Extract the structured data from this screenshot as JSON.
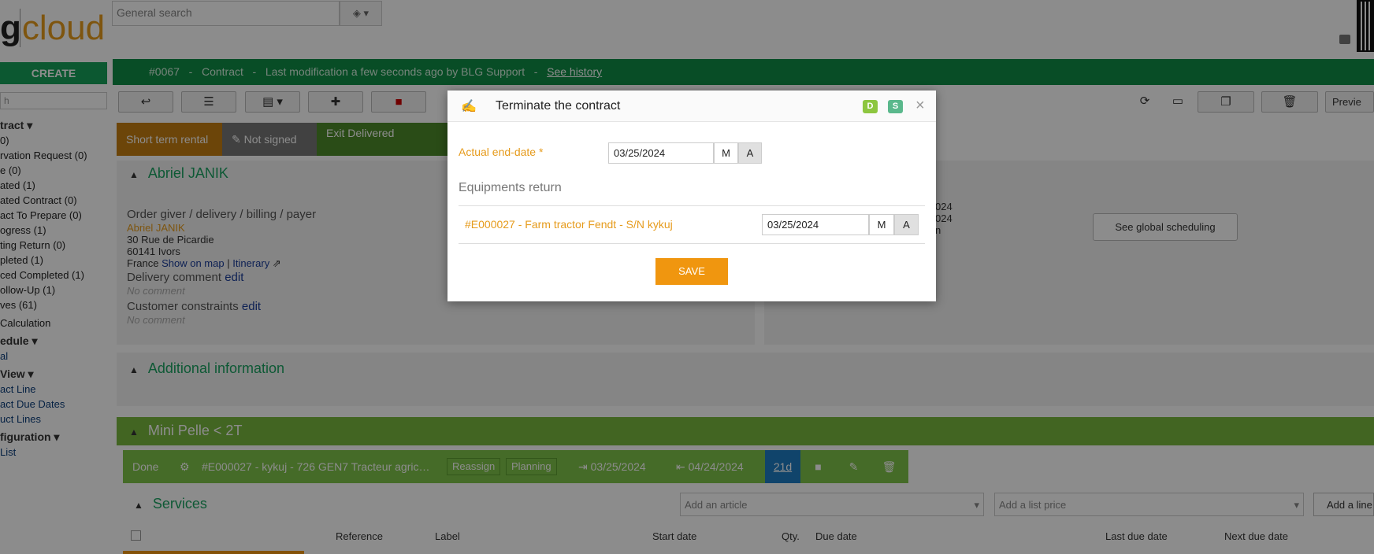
{
  "logo": {
    "part1": "g",
    "part2": "cloud"
  },
  "search": {
    "placeholder": "General search"
  },
  "sidebar": {
    "create_label": "CREATE",
    "filter_placeholder": "h",
    "sections": [
      {
        "title": "tract ▾",
        "items": [
          "",
          "0)",
          "rvation Request (0)",
          "e (0)",
          "ated (1)",
          "ated Contract (0)",
          "act To Prepare (0)",
          "ogress (1)",
          "ting Return (0)",
          "pleted (1)",
          "ced Completed (1)",
          "ollow-Up (1)",
          "ves (61)"
        ]
      },
      {
        "title": "",
        "items": [
          "Calculation"
        ]
      },
      {
        "title": "edule ▾",
        "items": [
          "al"
        ]
      },
      {
        "title": "View ▾",
        "items": [
          "act Line",
          "act Due Dates",
          "uct Lines"
        ]
      },
      {
        "title": "figuration ▾",
        "items": [
          "List"
        ]
      }
    ]
  },
  "topbar": {
    "id": "#0067",
    "type": "Contract",
    "modified": "Last modification a few seconds ago by BLG Support",
    "history": "See history",
    "sep": "-"
  },
  "toolbar": {
    "preview": "Previe"
  },
  "status": {
    "rental": "Short term rental",
    "signed": "Not signed",
    "exit": "Exit Delivered"
  },
  "customer": {
    "name": "Abriel JANIK",
    "role": "Order giver / delivery / billing / payer",
    "contact": "Abriel JANIK",
    "street": "30 Rue de Picardie",
    "city": "60141 Ivors",
    "country": "France",
    "show_map": "Show on map",
    "sep": "|",
    "itinerary": "Itinerary",
    "delivery_comment": "Delivery comment",
    "customer_constraints": "Customer constraints",
    "edit": "edit",
    "no_comment": "No comment"
  },
  "dates_partial": [
    "024",
    "024",
    "n"
  ],
  "global_scheduling": "See global scheduling",
  "additional_info": "Additional information",
  "group": {
    "title": "Mini Pelle < 2T"
  },
  "line": {
    "status": "Done",
    "equipment": "#E000027 - kykuj - 726 GEN7 Tracteur agric…",
    "reassign": "Reassign",
    "planning": "Planning",
    "start": "03/25/2024",
    "end": "04/24/2024",
    "duration": "21d"
  },
  "services": {
    "title": "Services",
    "add_article": "Add an article",
    "add_price": "Add a list price",
    "add_line": "Add a line"
  },
  "table_headers": [
    "Reference",
    "Label",
    "Start date",
    "Qty.",
    "Due date",
    "Last due date",
    "Next due date"
  ],
  "modal": {
    "title": "Terminate the contract",
    "badge_d": "D",
    "badge_s": "S",
    "close": "×",
    "end_date_label": "Actual end-date *",
    "end_date_value": "03/25/2024",
    "m": "M",
    "a": "A",
    "equipments_return": "Equipments return",
    "equipment_link": "#E000027 - Farm tractor Fendt - S/N kykuj",
    "equipment_date": "03/25/2024",
    "save": "SAVE"
  },
  "colors": {
    "green": "#0f8d45",
    "orange": "#f0960f",
    "accent_green": "#1aa362"
  }
}
